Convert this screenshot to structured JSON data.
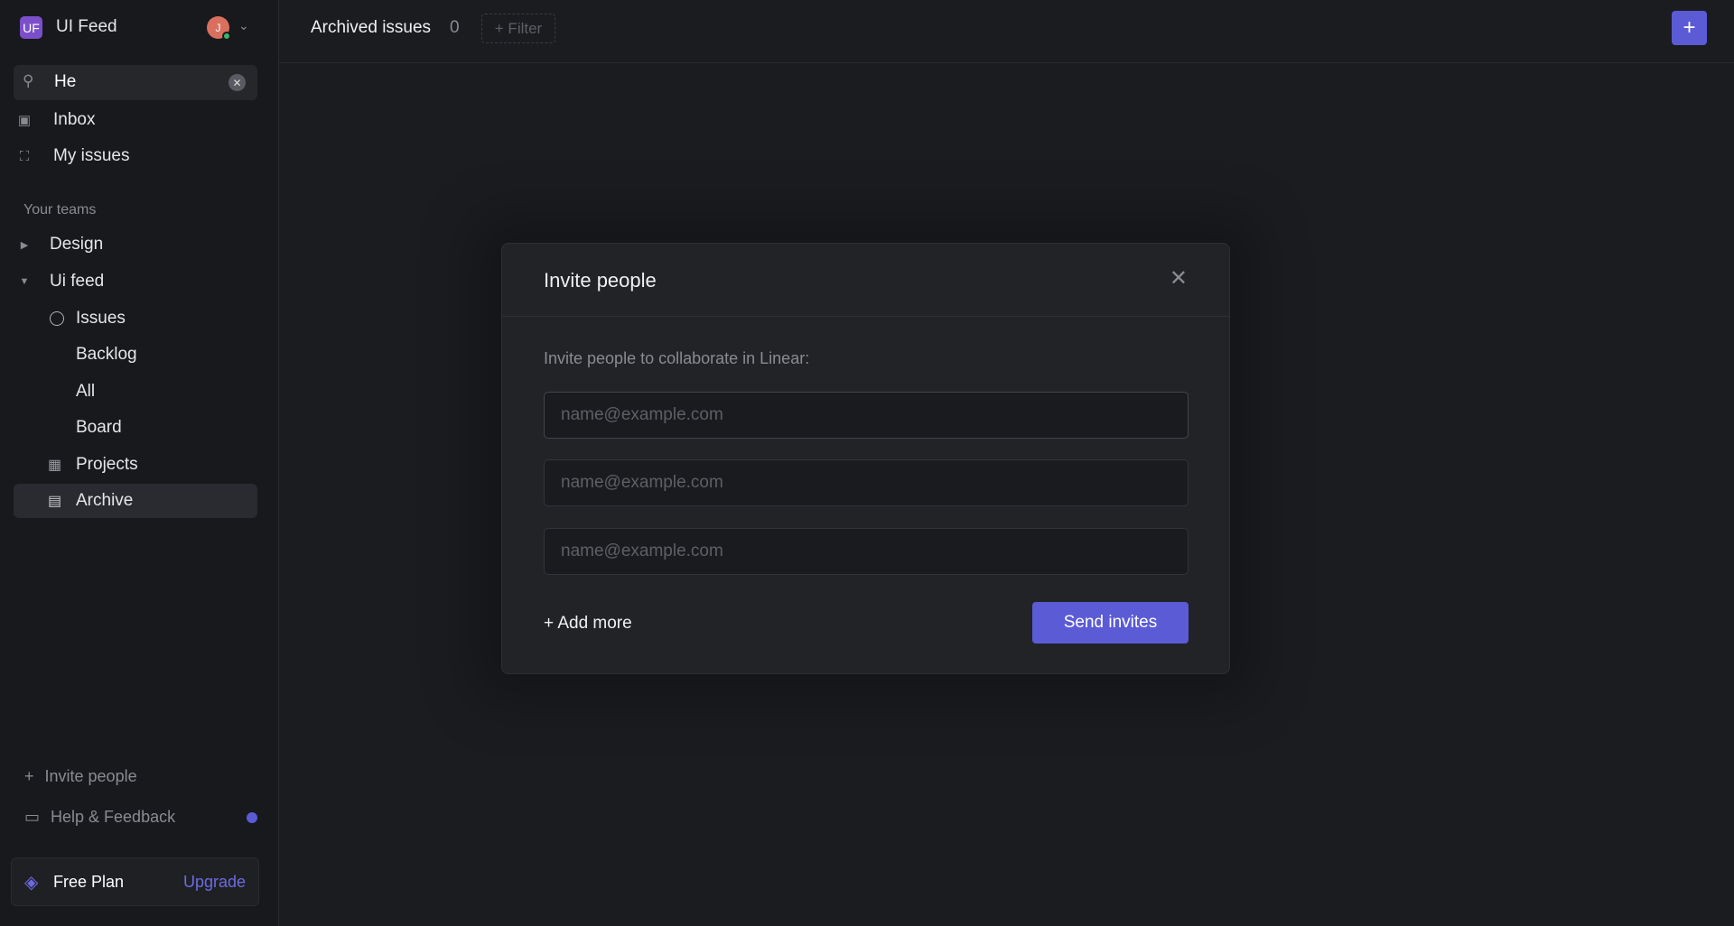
{
  "workspace": {
    "initials": "UF",
    "name": "UI Feed",
    "avatar_initial": "J",
    "accent": "#7b4fc9"
  },
  "search": {
    "value": "He"
  },
  "nav": {
    "inbox": "Inbox",
    "my_issues": "My issues"
  },
  "teams": {
    "heading": "Your teams",
    "design": "Design",
    "ui_feed": "Ui feed",
    "items": {
      "issues": "Issues",
      "backlog": "Backlog",
      "all": "All",
      "board": "Board",
      "projects": "Projects",
      "archive": "Archive"
    }
  },
  "footer": {
    "invite": "Invite people",
    "help": "Help & Feedback",
    "plan": "Free Plan",
    "upgrade": "Upgrade"
  },
  "header": {
    "title": "Archived issues",
    "count": "0",
    "filter": "+ Filter",
    "new_button": "+"
  },
  "modal": {
    "title": "Invite people",
    "subtitle": "Invite people to collaborate in Linear:",
    "placeholder": "name@example.com",
    "add_more": "+ Add more",
    "send": "Send invites"
  },
  "colors": {
    "primary": "#5b5bd6",
    "bg": "#1b1c20",
    "sidebar": "#18191c"
  }
}
